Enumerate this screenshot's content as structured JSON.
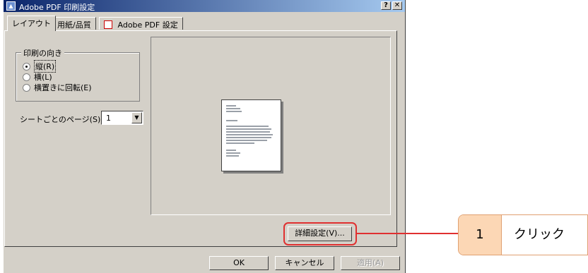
{
  "window": {
    "title": "Adobe PDF 印刷設定",
    "help_button": "?",
    "close_button": "✕"
  },
  "tabs": [
    {
      "label": "レイアウト",
      "active": true
    },
    {
      "label": "用紙/品質",
      "active": false
    },
    {
      "label": "Adobe PDF 設定",
      "active": false
    }
  ],
  "orientation": {
    "group_label": "印刷の向き",
    "options": [
      {
        "label": "縦(R)",
        "selected": true
      },
      {
        "label": "横(L)",
        "selected": false
      },
      {
        "label": "横置きに回転(E)",
        "selected": false
      }
    ]
  },
  "pages_per_sheet": {
    "label": "シートごとのページ(S):",
    "value": "1"
  },
  "buttons": {
    "advanced": "詳細設定(V)...",
    "ok": "OK",
    "cancel": "キャンセル",
    "apply": "適用(A)"
  },
  "callout": {
    "step": "1",
    "text": "クリック"
  },
  "colors": {
    "highlight": "#e03030",
    "callout_fill": "#fcd7b5",
    "callout_border": "#e0a070"
  }
}
